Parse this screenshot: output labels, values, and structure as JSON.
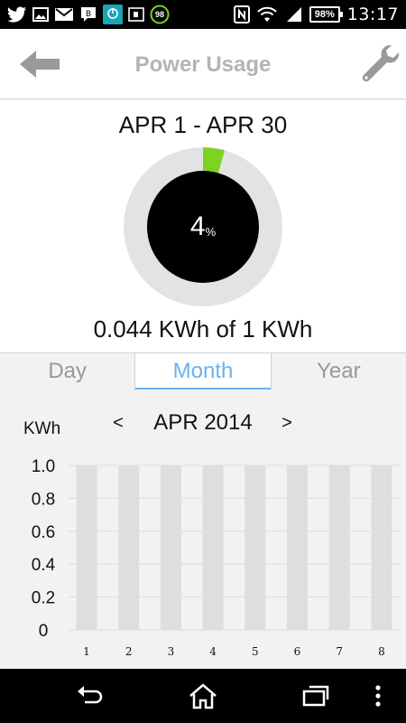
{
  "status_bar": {
    "time": "13:17",
    "battery_percent": "98%",
    "notification_badge": "98",
    "left_icons": [
      "twitter-icon",
      "gallery-icon",
      "gmail-icon",
      "chat-icon",
      "power-app-icon",
      "sim-card-icon",
      "update-badge-icon"
    ],
    "right_icons": [
      "nfc-icon",
      "wifi-icon",
      "signal-icon",
      "battery-icon"
    ]
  },
  "header": {
    "title": "Power Usage",
    "back_icon": "back-arrow-icon",
    "settings_icon": "wrench-icon"
  },
  "summary": {
    "date_range": "APR 1 - APR 30",
    "percent": "4",
    "percent_sign": "%",
    "percent_fraction": 0.044,
    "usage_text": "0.044 KWh of 1 KWh"
  },
  "tabs": [
    {
      "label": "Day",
      "active": false
    },
    {
      "label": "Month",
      "active": true
    },
    {
      "label": "Year",
      "active": false
    }
  ],
  "chart": {
    "unit_label": "KWh",
    "prev_label": "<",
    "next_label": ">",
    "period_label": "APR 2014"
  },
  "chart_data": {
    "type": "bar",
    "categories": [
      "1",
      "2",
      "3",
      "4",
      "5",
      "6",
      "7",
      "8"
    ],
    "values": [
      0,
      0,
      0,
      0,
      0,
      0,
      0,
      0
    ],
    "capacity": 1.0,
    "yticks": [
      "1.0",
      "0.8",
      "0.6",
      "0.4",
      "0.2",
      "0"
    ],
    "ylim": [
      0,
      1.0
    ],
    "ylabel": "KWh",
    "title": "APR 2014",
    "grid": true,
    "colors": {
      "bar_background": "#dedede",
      "bar_fill": "#7ed321",
      "grid": "#dcdcdc"
    }
  },
  "colors": {
    "accent": "#6ab1f0",
    "progress": "#7ed321",
    "ring_track": "#e2e4e4",
    "title_gray": "#b4b4b4"
  },
  "nav_bar": {
    "icons": [
      "back-nav-icon",
      "home-icon",
      "recent-apps-icon",
      "menu-icon"
    ]
  }
}
